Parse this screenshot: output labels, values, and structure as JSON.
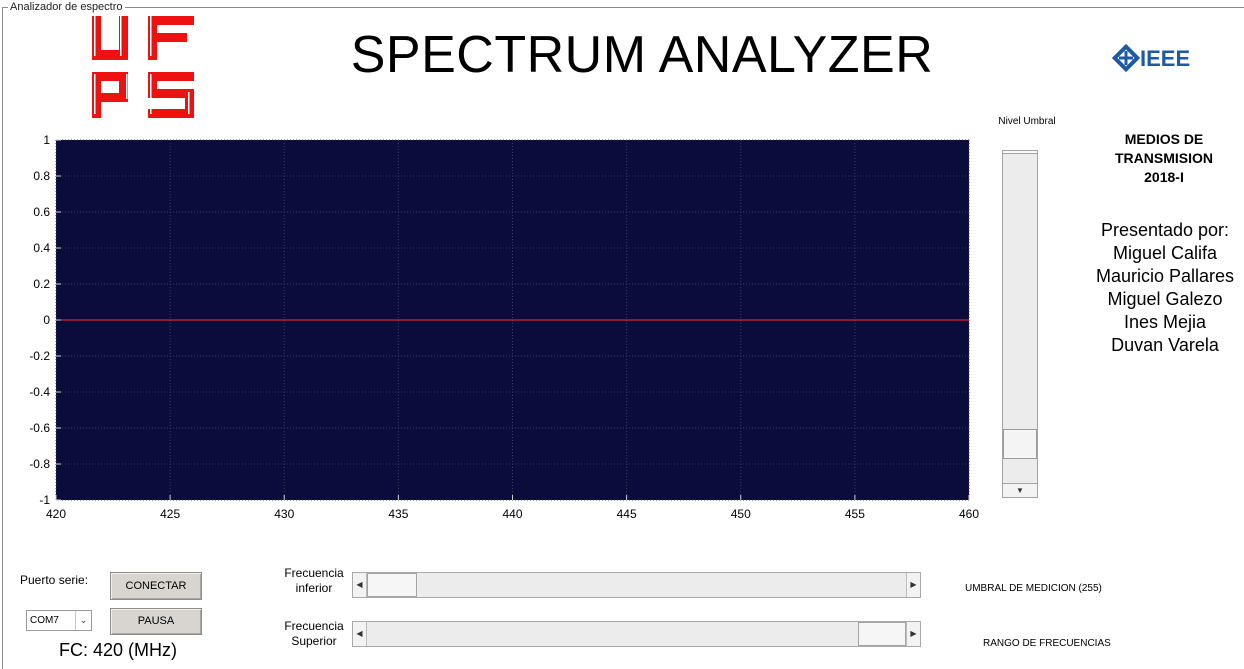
{
  "panel_title": "Analizador de espectro",
  "page_title": "SPECTRUM ANALYZER",
  "logos": {
    "left_name": "ufps-logo",
    "right_text": "IEEE"
  },
  "course": {
    "line1": "MEDIOS DE",
    "line2": "TRANSMISION",
    "line3": "2018-I"
  },
  "authors": {
    "heading": "Presentado por:",
    "names": [
      "Miguel Califa",
      "Mauricio Pallares",
      "Miguel Galezo",
      "Ines Mejia",
      "Duvan Varela"
    ]
  },
  "threshold_slider": {
    "label": "Nivel Umbral",
    "value_fraction": 0.08
  },
  "controls": {
    "serial_label": "Puerto serie:",
    "connect_label": "CONECTAR",
    "pause_label": "PAUSA",
    "port_value": "COM7",
    "fc_readout": "FC: 420 (MHz)",
    "lower_freq_label_1": "Frecuencia",
    "lower_freq_label_2": "inferior",
    "upper_freq_label_1": "Frecuencia",
    "upper_freq_label_2": "Superior",
    "lower_freq_position": 0.0,
    "upper_freq_position": 1.0,
    "threshold_text": "UMBRAL DE MEDICION (255)",
    "range_text": "RANGO DE FRECUENCIAS"
  },
  "colors": {
    "plot_bg": "#0b0c3b",
    "grid": "#3a3b63",
    "trace": "#ff2a2a",
    "ieee_blue": "#1c5aa6",
    "ufps_red": "#ee1111"
  },
  "chart_data": {
    "type": "line",
    "title": "",
    "xlabel": "",
    "ylabel": "",
    "xlim": [
      420,
      460
    ],
    "ylim": [
      -1,
      1
    ],
    "xticks": [
      "420",
      "425",
      "430",
      "435",
      "440",
      "445",
      "450",
      "455",
      "460"
    ],
    "yticks": [
      "1",
      "0.8",
      "0.6",
      "0.4",
      "0.2",
      "0",
      "-0.2",
      "-0.4",
      "-0.6",
      "-0.8",
      "-1"
    ],
    "grid": true,
    "series": [
      {
        "x": [
          420,
          460
        ],
        "y": [
          0,
          0
        ]
      }
    ]
  }
}
